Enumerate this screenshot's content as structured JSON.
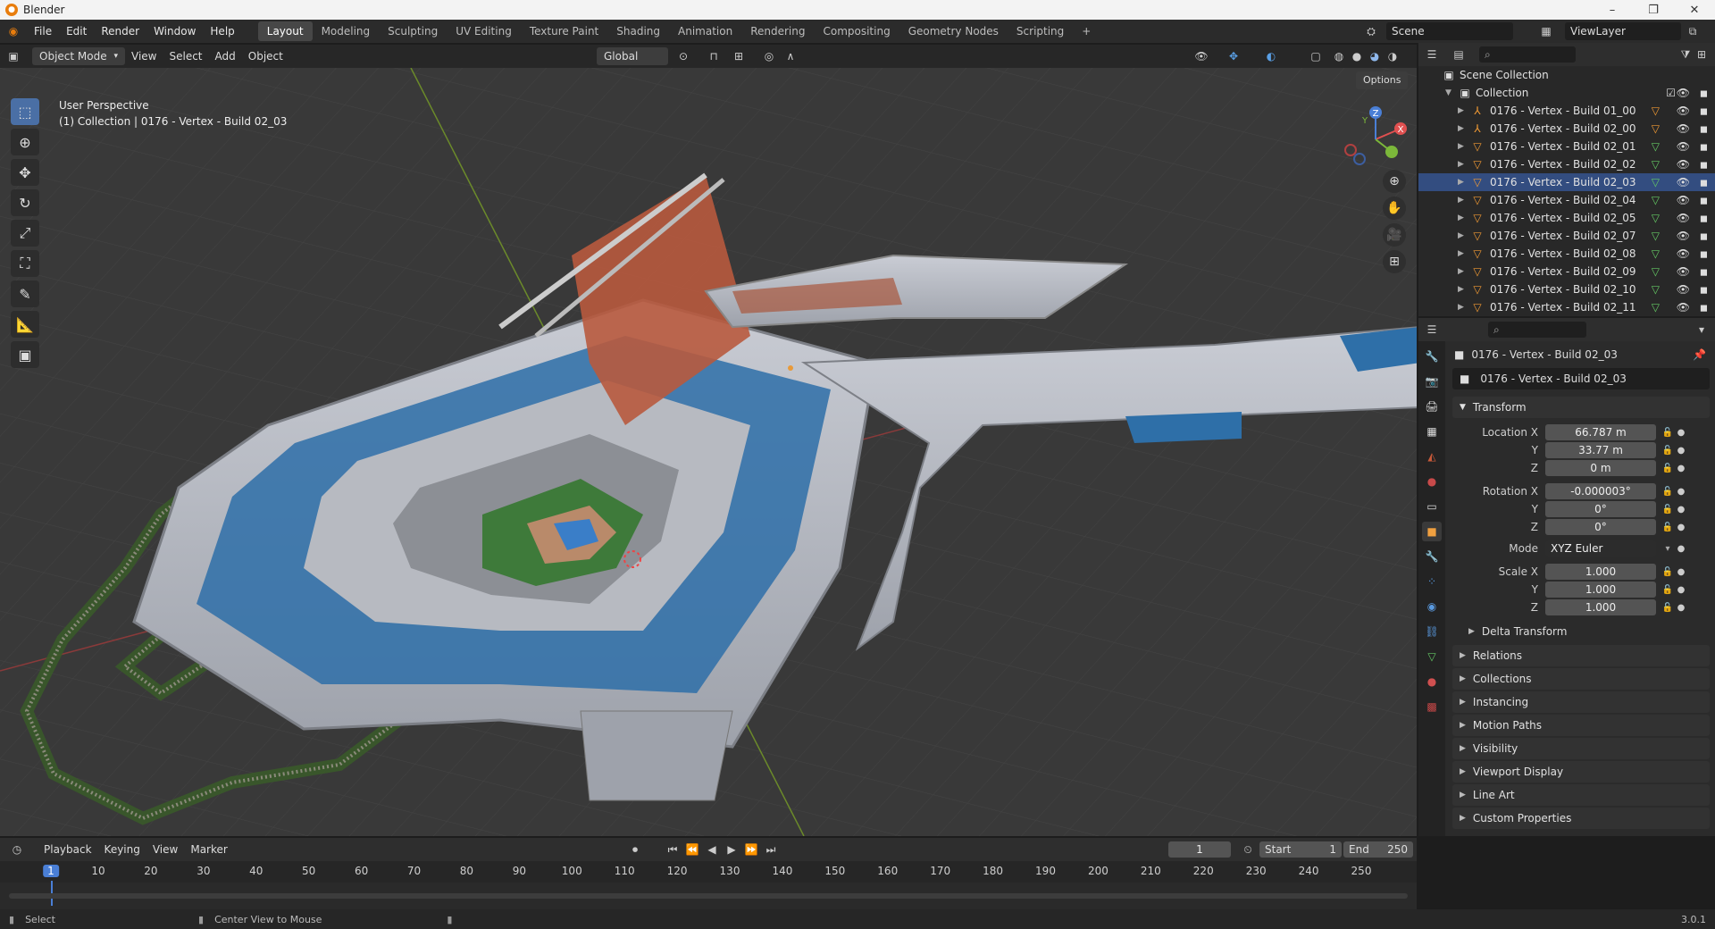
{
  "window": {
    "title": "Blender",
    "min": "–",
    "max": "❐",
    "close": "✕"
  },
  "menu": [
    "File",
    "Edit",
    "Render",
    "Window",
    "Help"
  ],
  "workspaces": [
    "Layout",
    "Modeling",
    "Sculpting",
    "UV Editing",
    "Texture Paint",
    "Shading",
    "Animation",
    "Rendering",
    "Compositing",
    "Geometry Nodes",
    "Scripting"
  ],
  "workspace_add": "+",
  "scene": {
    "name": "Scene",
    "view_layer": "ViewLayer"
  },
  "viewport_header": {
    "mode": "Object Mode",
    "menus": [
      "View",
      "Select",
      "Add",
      "Object"
    ],
    "orientation": "Global",
    "options": "Options"
  },
  "viewport": {
    "perspective": "User Perspective",
    "collection_info": "(1) Collection | 0176 - Vertex - Build 02_03",
    "gizmo": {
      "x": "X",
      "y": "Y",
      "z": "Z"
    }
  },
  "outliner": {
    "scene_collection": "Scene Collection",
    "collection": "Collection",
    "items": [
      "0176 - Vertex - Build 01_00",
      "0176 - Vertex - Build 02_00",
      "0176 - Vertex - Build 02_01",
      "0176 - Vertex - Build 02_02",
      "0176 - Vertex - Build 02_03",
      "0176 - Vertex - Build 02_04",
      "0176 - Vertex - Build 02_05",
      "0176 - Vertex - Build 02_07",
      "0176 - Vertex - Build 02_08",
      "0176 - Vertex - Build 02_09",
      "0176 - Vertex - Build 02_10",
      "0176 - Vertex - Build 02_11"
    ]
  },
  "properties": {
    "object_name": "0176 - Vertex - Build 02_03",
    "object_field": "0176 - Vertex - Build 02_03",
    "transform_label": "Transform",
    "location_label": "Location X",
    "location": {
      "x": "66.787 m",
      "y": "33.77 m",
      "z": "0 m"
    },
    "rotation_label": "Rotation X",
    "rotation": {
      "x": "-0.000003°",
      "y": "0°",
      "z": "0°"
    },
    "mode_label": "Mode",
    "mode": "XYZ Euler",
    "scale_label": "Scale X",
    "scale": {
      "x": "1.000",
      "y": "1.000",
      "z": "1.000"
    },
    "axis_y": "Y",
    "axis_z": "Z",
    "panels": [
      "Delta Transform",
      "Relations",
      "Collections",
      "Instancing",
      "Motion Paths",
      "Visibility",
      "Viewport Display",
      "Line Art",
      "Custom Properties"
    ]
  },
  "timeline": {
    "menus": [
      "Playback",
      "Keying",
      "View",
      "Marker"
    ],
    "current_frame": "1",
    "start_label": "Start",
    "start": "1",
    "end_label": "End",
    "end": "250",
    "ticks": [
      "1",
      "10",
      "20",
      "30",
      "40",
      "50",
      "60",
      "70",
      "80",
      "90",
      "100",
      "110",
      "120",
      "130",
      "140",
      "150",
      "160",
      "170",
      "180",
      "190",
      "200",
      "210",
      "220",
      "230",
      "240",
      "250"
    ]
  },
  "status": {
    "select": "Select",
    "center": "Center View to Mouse",
    "version": "3.0.1"
  }
}
